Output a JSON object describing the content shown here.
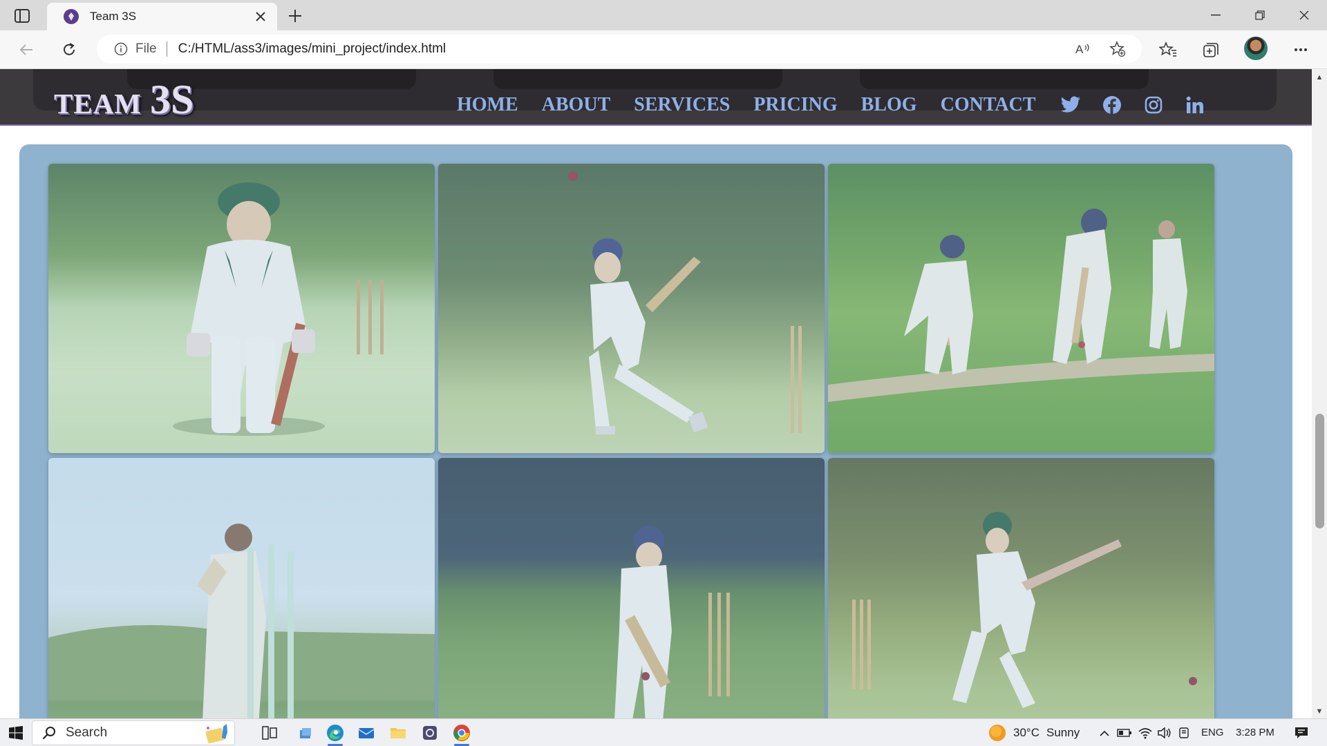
{
  "browser": {
    "tab_title": "Team 3S",
    "new_tab_icon": "plus-icon",
    "address_scheme": "File",
    "address_url": "C:/HTML/ass3/images/mini_project/index.html"
  },
  "site": {
    "logo_part1": "TEAM",
    "logo_part2": "3S",
    "nav": [
      {
        "label": "HOME"
      },
      {
        "label": "ABOUT"
      },
      {
        "label": "SERVICES"
      },
      {
        "label": "PRICING"
      },
      {
        "label": "BLOG"
      },
      {
        "label": "CONTACT"
      }
    ],
    "social_icons": [
      "twitter-icon",
      "facebook-icon",
      "instagram-icon",
      "linkedin-icon"
    ],
    "colors": {
      "header_bg": "#3d3a3e",
      "nav_link": "#8eb0ea",
      "gallery_bg": "#8fb2cf"
    }
  },
  "gallery": {
    "photos": [
      {
        "subject": "batter-standing"
      },
      {
        "subject": "batter-swinging"
      },
      {
        "subject": "match-at-crease"
      },
      {
        "subject": "wicketkeeper-stumps"
      },
      {
        "subject": "batter-defending"
      },
      {
        "subject": "batter-cut-shot"
      }
    ]
  },
  "taskbar": {
    "search_label": "Search",
    "weather_temp": "30°C",
    "weather_text": "Sunny",
    "language": "ENG",
    "time": "3:28 PM"
  }
}
